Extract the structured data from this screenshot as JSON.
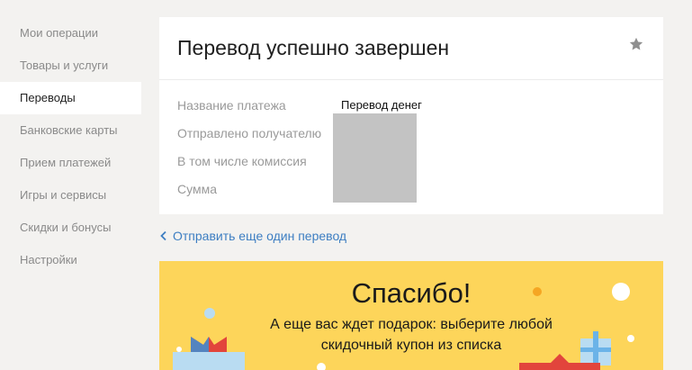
{
  "sidebar": {
    "items": [
      {
        "label": "Мои операции"
      },
      {
        "label": "Товары и услуги"
      },
      {
        "label": "Переводы"
      },
      {
        "label": "Банковские карты"
      },
      {
        "label": "Прием платежей"
      },
      {
        "label": "Игры и сервисы"
      },
      {
        "label": "Скидки и бонусы"
      },
      {
        "label": "Настройки"
      }
    ],
    "active_index": 2
  },
  "card": {
    "title": "Перевод успешно завершен",
    "star_icon": "star-icon",
    "details": {
      "payment_name_label": "Название платежа",
      "payment_name_value": "Перевод денег",
      "recipient_label": "Отправлено получателю",
      "commission_label": "В том числе комиссия",
      "sum_label": "Сумма"
    }
  },
  "back_link": {
    "label": "Отправить еще один перевод",
    "icon": "chevron-left-icon"
  },
  "promo": {
    "title": "Спасибо!",
    "text": "А еще вас ждет подарок: выберите любой скидочный купон из списка"
  },
  "colors": {
    "background": "#f3f2f0",
    "card": "#ffffff",
    "link": "#3d7ec2",
    "promo": "#fdd55a",
    "muted_text": "#9a9a9a"
  }
}
